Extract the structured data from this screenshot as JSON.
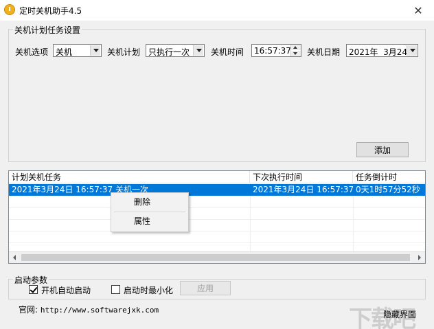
{
  "window": {
    "title": "定时关机助手4.5",
    "close_glyph": "✕"
  },
  "settings_group": {
    "title": "关机计划任务设置",
    "option_label": "关机选项",
    "option_value": "关机",
    "plan_label": "关机计划",
    "plan_value": "只执行一次",
    "time_label": "关机时间",
    "time_value": "16:57:37",
    "date_label": "关机日期",
    "date_value": "2021年  3月24日",
    "add_button": "添加"
  },
  "task_list": {
    "columns": [
      "计划关机任务",
      "下次执行时间",
      "任务倒计时"
    ],
    "rows": [
      {
        "task": "2021年3月24日 16:57:37 关机一次",
        "next_run": "2021年3月24日 16:57:37",
        "countdown": "0天1时57分52秒",
        "selected": true
      }
    ]
  },
  "context_menu": {
    "items": [
      "删除",
      "属性"
    ]
  },
  "startup_group": {
    "title": "启动参数",
    "autostart_label": "开机自动启动",
    "autostart_checked": true,
    "minimize_label": "启动时最小化",
    "minimize_checked": false,
    "apply_button": "应用"
  },
  "footer": {
    "website_label": "官网:",
    "website_url": "http://www.softwarejxk.com",
    "hide_button": "隐藏界面"
  },
  "watermark_text": "下载吧",
  "colors": {
    "selection": "#0078d7",
    "dialog_bg": "#f0f0f0"
  },
  "icons": {
    "app": "power-icon",
    "close": "close-icon"
  }
}
